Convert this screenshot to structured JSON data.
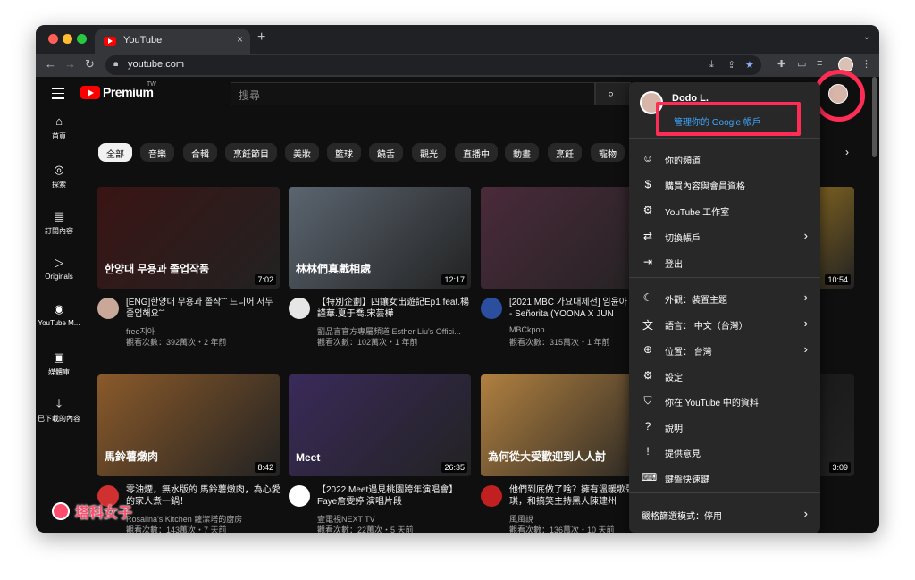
{
  "browser": {
    "tab_title": "YouTube",
    "close": "×",
    "new_tab": "+",
    "tab_menu": "⌄",
    "url": "youtube.com"
  },
  "yt": {
    "logo_text": "Premium",
    "logo_region": "TW",
    "search_placeholder": "搜尋"
  },
  "sidebar": [
    {
      "icon": "home-icon",
      "glyph": "⌂",
      "label": "首頁"
    },
    {
      "icon": "compass-icon",
      "glyph": "◎",
      "label": "探索"
    },
    {
      "icon": "subscriptions-icon",
      "glyph": "▤",
      "label": "訂閱內容"
    },
    {
      "icon": "originals-icon",
      "glyph": "▷",
      "label": "Originals"
    },
    {
      "icon": "youtube-music-icon",
      "glyph": "◉",
      "label": "YouTube M..."
    },
    {
      "icon": "library-icon",
      "glyph": "▣",
      "label": "媒體庫"
    },
    {
      "icon": "download-icon",
      "glyph": "⤓",
      "label": "已下載的內容"
    }
  ],
  "chips": [
    "全部",
    "音樂",
    "合輯",
    "烹飪節目",
    "美妝",
    "籃球",
    "饒舌",
    "觀光",
    "直播中",
    "動畫",
    "烹飪",
    "寵物"
  ],
  "videos": [
    {
      "title": "[ENG]한양대 무용과 졸작ˆˆ 드디어 저두 졸업해요ˆˆ",
      "channel": "free지아",
      "meta": "觀看次數：392萬次・2 年前",
      "duration": "7:02",
      "thumb_text": "한양대 무용과 졸업작품",
      "color": "#3a1414"
    },
    {
      "title": "【特別企劃】四鑲女出遊記Ep1 feat.楊謹華.夏于喬.宋芸樺",
      "channel": "劉品言官方專屬頻道 Esther Liu's Offici...",
      "meta": "觀看次數：102萬次・1 年前",
      "duration": "12:17",
      "thumb_text": "林林們真戲相處",
      "color": "#5b6570"
    },
    {
      "title": "[2021 MBC 가요대제전] 임윤아 X 이준호 - Señorita (YOONA X JUN",
      "channel": "MBCkpop",
      "meta": "觀看次數：315萬次・1 年前",
      "duration": "",
      "thumb_text": "",
      "color": "#4a2a3a"
    },
    {
      "title": "零油煙，無水版的 馬鈴薯燉肉，為心愛的家人煮一鍋！",
      "channel": "Rosalina's Kitchen 蘿潔塔的廚房",
      "meta": "觀看次數：143萬次・7 天前",
      "duration": "8:42",
      "thumb_text": "馬鈴薯燉肉",
      "color": "#8a5a2a"
    },
    {
      "title": "【2022 Meet遇見桃園跨年演唱會】Faye詹雯婷 演唱片段",
      "channel": "壹電視NEXT TV",
      "meta": "觀看次數：22萬次・5 天前",
      "duration": "26:35",
      "thumb_text": "Meet",
      "color": "#3a2a5a"
    },
    {
      "title": "他們到底做了啥？擁有溫暖歌聲的范瑋琪，和搞笑主持黑人陳建州",
      "channel": "風風說",
      "meta": "觀看次數：136萬次・10 天前",
      "duration": "",
      "thumb_text": "為何從大受歡迎到人人討",
      "color": "#b08040"
    },
    {
      "title": "",
      "channel": "",
      "meta": "",
      "duration": "10:54",
      "thumb_text": "",
      "color": "#d8a020"
    },
    {
      "title": "",
      "channel": "",
      "meta": "",
      "duration": "3:09",
      "thumb_text": "",
      "color": "#111111"
    }
  ],
  "menu": {
    "user_name": "Dodo L.",
    "manage": "管理你的 Google 帳戶",
    "items": [
      {
        "icon": "channel-icon",
        "glyph": "☺",
        "label": "你的頻道",
        "arrow": false
      },
      {
        "icon": "purchases-icon",
        "glyph": "$",
        "label": "購買內容與會員資格",
        "arrow": false
      },
      {
        "icon": "studio-icon",
        "glyph": "⚙",
        "label": "YouTube 工作室",
        "arrow": false
      },
      {
        "icon": "switch-account-icon",
        "glyph": "⇄",
        "label": "切換帳戶",
        "arrow": true
      },
      {
        "icon": "sign-out-icon",
        "glyph": "⇥",
        "label": "登出",
        "arrow": false
      },
      {
        "icon": "appearance-icon",
        "glyph": "☾",
        "label": "外觀：裝置主題",
        "arrow": true
      },
      {
        "icon": "language-icon",
        "glyph": "文",
        "label": "語言： 中文（台灣）",
        "arrow": true
      },
      {
        "icon": "location-icon",
        "glyph": "⊕",
        "label": "位置： 台灣",
        "arrow": true
      },
      {
        "icon": "settings-icon",
        "glyph": "⚙",
        "label": "設定",
        "arrow": false
      },
      {
        "icon": "your-data-icon",
        "glyph": "⛉",
        "label": "你在 YouTube 中的資料",
        "arrow": false
      },
      {
        "icon": "help-icon",
        "glyph": "?",
        "label": "說明",
        "arrow": false
      },
      {
        "icon": "feedback-icon",
        "glyph": "!",
        "label": "提供意見",
        "arrow": false
      },
      {
        "icon": "keyboard-icon",
        "glyph": "⌨",
        "label": "鍵盤快速鍵",
        "arrow": false
      },
      {
        "icon": "",
        "glyph": "",
        "label": "嚴格篩選模式：停用",
        "arrow": true
      }
    ]
  },
  "watermark": "塔科女子",
  "colors": {
    "accent": "#ff0000",
    "highlight": "#ff2d55",
    "link": "#3ea6ff"
  }
}
